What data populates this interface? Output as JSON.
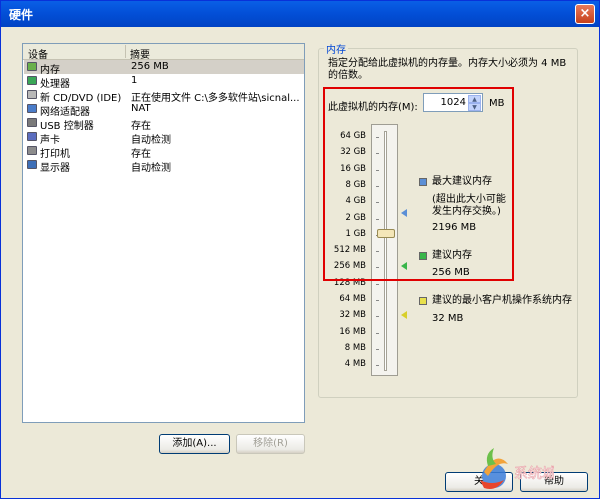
{
  "window": {
    "title": "硬件",
    "close": "×"
  },
  "device_list": {
    "headers": [
      "设备",
      "摘要"
    ],
    "rows": [
      {
        "device": "内存",
        "summary": "256 MB",
        "icon": "memory-icon",
        "color": "#6ab04c"
      },
      {
        "device": "处理器",
        "summary": "1",
        "icon": "cpu-icon",
        "color": "#3aa757"
      },
      {
        "device": "新 CD/DVD (IDE)",
        "summary": "正在使用文件 C:\\多多软件站\\sicnal...",
        "icon": "cd-icon",
        "color": "#b8b8b8"
      },
      {
        "device": "网络适配器",
        "summary": "NAT",
        "icon": "network-icon",
        "color": "#4a7cc9"
      },
      {
        "device": "USB 控制器",
        "summary": "存在",
        "icon": "usb-icon",
        "color": "#7a7a7a"
      },
      {
        "device": "声卡",
        "summary": "自动检测",
        "icon": "speaker-icon",
        "color": "#5b6dbf"
      },
      {
        "device": "打印机",
        "summary": "存在",
        "icon": "printer-icon",
        "color": "#8c8c8c"
      },
      {
        "device": "显示器",
        "summary": "自动检测",
        "icon": "monitor-icon",
        "color": "#3d6fb8"
      }
    ]
  },
  "buttons": {
    "add": "添加(A)...",
    "remove": "移除(R)",
    "ok": "关",
    "help": "帮助"
  },
  "memory": {
    "group_title": "内存",
    "description": "指定分配给此虚拟机的内存量。内存大小必须为 4 MB 的倍数。",
    "spin_label": "此虚拟机的内存(M):",
    "value": "1024",
    "unit": "MB",
    "scale": [
      "64 GB",
      "32 GB",
      "16 GB",
      "8 GB",
      "4 GB",
      "2 GB",
      "1 GB",
      "512 MB",
      "256 MB",
      "128 MB",
      "64 MB",
      "32 MB",
      "16 MB",
      "8 MB",
      "4 MB"
    ],
    "legend": {
      "max_title": "最大建议内存",
      "max_note1": "(超出此大小可能",
      "max_note2": "发生内存交换。)",
      "max_value": "2196 MB",
      "rec_title": "建议内存",
      "rec_value": "256 MB",
      "min_title": "建议的最小客户机操作系统内存",
      "min_value": "32 MB"
    },
    "colors": {
      "max": "#5b8fd6",
      "rec": "#39b54a",
      "min": "#e8e04c"
    }
  },
  "watermark": {
    "text": "系统城"
  }
}
